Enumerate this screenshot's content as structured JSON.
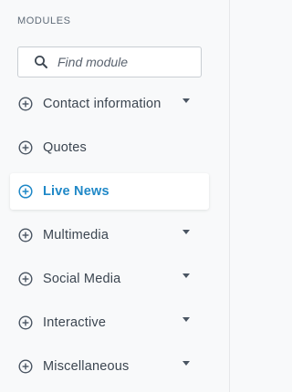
{
  "panel": {
    "title": "MODULES"
  },
  "search": {
    "placeholder": "Find module",
    "value": ""
  },
  "items": [
    {
      "label": "Contact information",
      "has_caret": true,
      "active": false
    },
    {
      "label": "Quotes",
      "has_caret": false,
      "active": false
    },
    {
      "label": "Live News",
      "has_caret": false,
      "active": true
    },
    {
      "label": "Multimedia",
      "has_caret": true,
      "active": false
    },
    {
      "label": "Social Media",
      "has_caret": true,
      "active": false
    },
    {
      "label": "Interactive",
      "has_caret": true,
      "active": false
    },
    {
      "label": "Miscellaneous",
      "has_caret": true,
      "active": false
    }
  ],
  "colors": {
    "background": "#f8f9fa",
    "text": "#3b4550",
    "icon": "#4a5562",
    "accent": "#1f88c7"
  },
  "icons": {
    "search": "search-icon",
    "item": "plus-circle-icon",
    "expand": "caret-down-icon"
  }
}
